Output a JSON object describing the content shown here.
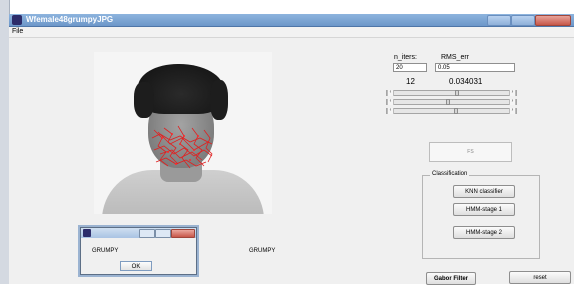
{
  "window": {
    "title": "Wfemale48grumpyJPG",
    "menu": [
      "File"
    ]
  },
  "image": {
    "description_icon": "face-photo"
  },
  "params": {
    "n_iters_label": "n_iters:",
    "rms_err_label": "RMS_err",
    "n_iters_value": "20",
    "rms_err_value": "0.05",
    "n_iters_result": "12",
    "rms_err_result": "0.034031"
  },
  "sliders": [
    {
      "value_fraction": 0.53
    },
    {
      "value_fraction": 0.45
    },
    {
      "value_fraction": 0.52
    }
  ],
  "fs_button": {
    "label": "FS"
  },
  "classification": {
    "title": "Classification",
    "buttons": [
      "KNN classifier",
      "HMM-stage 1",
      "HMM-stage 2"
    ]
  },
  "dialog": {
    "message": "GRUMPY",
    "ok_label": "OK"
  },
  "result_label": "GRUMPY",
  "bottom_buttons": {
    "gabor": "Gabor Filter",
    "reset": "reset"
  },
  "colors": {
    "titlebar": "#6d97c9",
    "figure_bg": "#f0f0f0",
    "overlay": "#e02020"
  }
}
